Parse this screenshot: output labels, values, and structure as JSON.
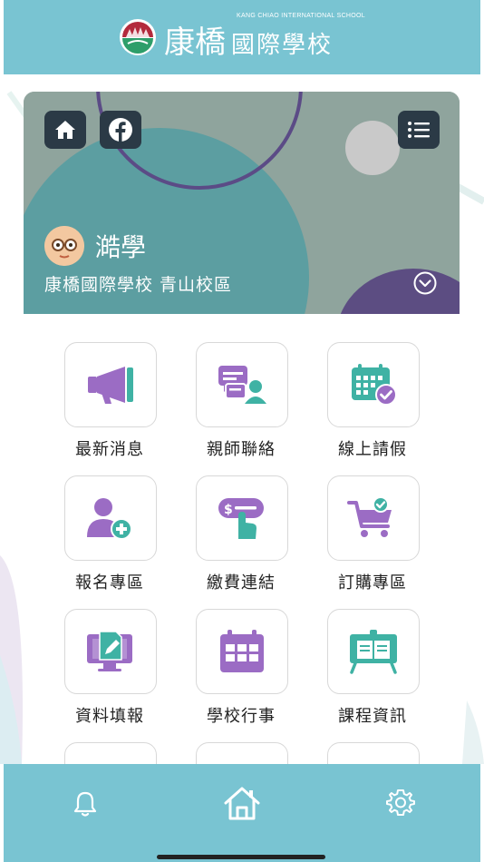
{
  "header": {
    "logo_en": "KANG CHIAO INTERNATIONAL SCHOOL",
    "logo_zh_main": "康橋",
    "logo_zh_sub": "國際學校"
  },
  "hero": {
    "student_name": "澔學",
    "school_campus": "康橋國際學校 青山校區",
    "buttons": [
      "home-icon",
      "facebook-icon",
      "list-menu-icon"
    ]
  },
  "menu": {
    "items": [
      {
        "label": "最新消息",
        "icon": "megaphone-icon"
      },
      {
        "label": "親師聯絡",
        "icon": "chat-contact-icon"
      },
      {
        "label": "線上請假",
        "icon": "calendar-check-icon"
      },
      {
        "label": "報名專區",
        "icon": "user-add-icon"
      },
      {
        "label": "繳費連結",
        "icon": "payment-tap-icon"
      },
      {
        "label": "訂購專區",
        "icon": "cart-check-icon"
      },
      {
        "label": "資料填報",
        "icon": "monitor-edit-icon"
      },
      {
        "label": "學校行事",
        "icon": "calendar-icon"
      },
      {
        "label": "課程資訊",
        "icon": "board-book-icon"
      }
    ]
  },
  "bottom_nav": {
    "items": [
      "bell-icon",
      "home-icon",
      "gear-icon"
    ]
  },
  "colors": {
    "brand": "#79c4d2",
    "purple": "#9b6cc4",
    "teal": "#3fb2a4",
    "dark_button": "#2b3a46"
  }
}
